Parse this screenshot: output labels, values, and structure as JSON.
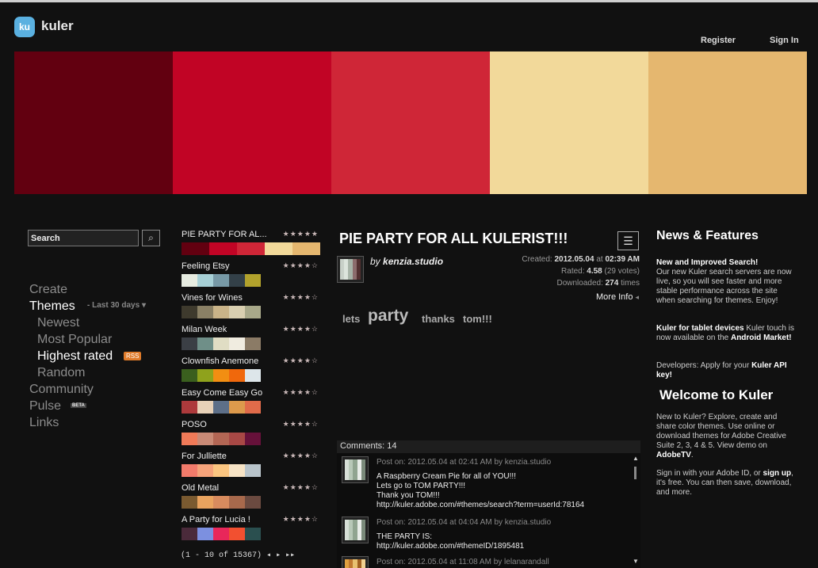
{
  "header": {
    "logo": "ku",
    "brand": "kuler",
    "register": "Register",
    "signin": "Sign In"
  },
  "hero_colors": [
    "#620010",
    "#c10425",
    "#cf2637",
    "#f2d99a",
    "#e5b76f"
  ],
  "search": {
    "placeholder": "Search",
    "icon": "search-icon"
  },
  "nav": {
    "create": "Create",
    "themes": "Themes",
    "themes_suffix": "- Last 30 days",
    "newest": "Newest",
    "most_popular": "Most Popular",
    "highest_rated": "Highest rated",
    "rss": "RSS",
    "random": "Random",
    "community": "Community",
    "pulse": "Pulse",
    "beta": "BETA",
    "links": "Links"
  },
  "themes": [
    {
      "name": "PIE PARTY  FOR AL...",
      "rating": 5,
      "colors": [
        "#620010",
        "#c10425",
        "#cf2637",
        "#f2d99a",
        "#e5b76f"
      ]
    },
    {
      "name": "Feeling Etsy",
      "rating": 4,
      "colors": [
        "#e6ebe0",
        "#a7d0d6",
        "#7799a6",
        "#334048",
        "#b2a22c"
      ]
    },
    {
      "name": "Vines for Wines",
      "rating": 4,
      "colors": [
        "#3e3a2d",
        "#8a8065",
        "#c9b388",
        "#d9cfb0",
        "#a8a889"
      ]
    },
    {
      "name": "Milan Week",
      "rating": 4,
      "colors": [
        "#3b3f45",
        "#6f8f88",
        "#e0ddc4",
        "#f0ece0",
        "#8b7b66"
      ]
    },
    {
      "name": "Clownfish Anemone",
      "rating": 4,
      "colors": [
        "#3a5f1e",
        "#8fa21c",
        "#f28e12",
        "#f0680c",
        "#dde6ea"
      ]
    },
    {
      "name": "Easy Come Easy Go",
      "rating": 4,
      "colors": [
        "#ad3a3c",
        "#e8d2b8",
        "#5d6f88",
        "#dd9a4c",
        "#e06b4a"
      ]
    },
    {
      "name": "POSO",
      "rating": 4,
      "colors": [
        "#f07a58",
        "#c98a76",
        "#b36654",
        "#a84845",
        "#66113a"
      ]
    },
    {
      "name": "For Julliette",
      "rating": 4,
      "colors": [
        "#f27b6b",
        "#f5a37a",
        "#fbc580",
        "#f7e3c5",
        "#b9c4cb"
      ]
    },
    {
      "name": "Old Metal",
      "rating": 4,
      "colors": [
        "#7a5a30",
        "#e9a35f",
        "#d88b5e",
        "#a8694c",
        "#6b4a40"
      ]
    },
    {
      "name": "A Party for Lucia !",
      "rating": 4,
      "colors": [
        "#4a2a3a",
        "#7c90e0",
        "#e8275a",
        "#f25030",
        "#2a4f4f"
      ]
    }
  ],
  "pager": {
    "text": "(1 - 10 of 15367)",
    "prev": "◂",
    "next": "▸",
    "last": "▸▸"
  },
  "detail": {
    "title": "PIE PARTY  FOR ALL KULERIST!!!",
    "by_prefix": "by",
    "author": "kenzia.studio",
    "created_label": "Created:",
    "created_date": "2012.05.04",
    "created_at": "at",
    "created_time": "02:39 AM",
    "rated_label": "Rated:",
    "rated_value": "4.58",
    "votes": "(29 votes)",
    "downloaded_label": "Downloaded:",
    "downloaded_value": "274",
    "downloaded_suffix": "times",
    "more_info": "More Info",
    "thumb_colors": [
      "#c8d0c8",
      "#dce4dc",
      "#a8b4a8",
      "#8c6c6c",
      "#523030"
    ],
    "tags": [
      {
        "text": "lets",
        "size": 13
      },
      {
        "text": "party",
        "size": 21
      },
      {
        "text": "thanks",
        "size": 13
      },
      {
        "text": "tom!!!",
        "size": 13
      }
    ]
  },
  "comments": {
    "header": "Comments: 14",
    "items": [
      {
        "meta": "Post on: 2012.05.04 at 02:41 AM by kenzia.studio",
        "body": "A Raspberry Cream Pie  for all of YOU!!!\nLets go to TOM PARTY!!!\nThank you TOM!!!\nhttp://kuler.adobe.com/#themes/search?term=userId:78164",
        "colors": [
          "#d8e0d8",
          "#b8c8b8",
          "#90a490",
          "#e8ece8",
          "#7a8a7a"
        ]
      },
      {
        "meta": "Post on: 2012.05.04 at 04:04 AM by kenzia.studio",
        "body": "THE PARTY IS:\nhttp://kuler.adobe.com/#themeID/1895481",
        "colors": [
          "#d8e0d8",
          "#b8c8b8",
          "#90a490",
          "#e8ece8",
          "#7a8a7a"
        ]
      },
      {
        "meta": "Post on: 2012.05.04 at 11:08 AM by lelanarandall",
        "body": "",
        "colors": [
          "#e0a040",
          "#c07830",
          "#e8c070",
          "#a06020",
          "#f0d090"
        ]
      }
    ]
  },
  "news": {
    "title": "News & Features",
    "item1_bold": "New and Improved Search!",
    "item1_text": "Our new Kuler search servers are now live, so you will see faster and more stable performance across the site when searching for themes.  Enjoy!",
    "item2_bold": "Kuler for tablet devices",
    "item2_text": " Kuler touch is now available on the ",
    "item2_link": "Android Market!",
    "item3_text": "Developers: Apply for your ",
    "item3_link": "Kuler API key!",
    "welcome_title": "Welcome to Kuler",
    "welcome_text": "New to Kuler? Explore, create and share color themes. Use online or download themes for Adobe Creative Suite 2, 3, 4 & 5. View demo on ",
    "welcome_link": "AdobeTV",
    "welcome_end": ".",
    "signin_text": "Sign in with your Adobe ID, or ",
    "signup_link": "sign up",
    "signin_end": ", it's free. You can then save, download, and more."
  }
}
